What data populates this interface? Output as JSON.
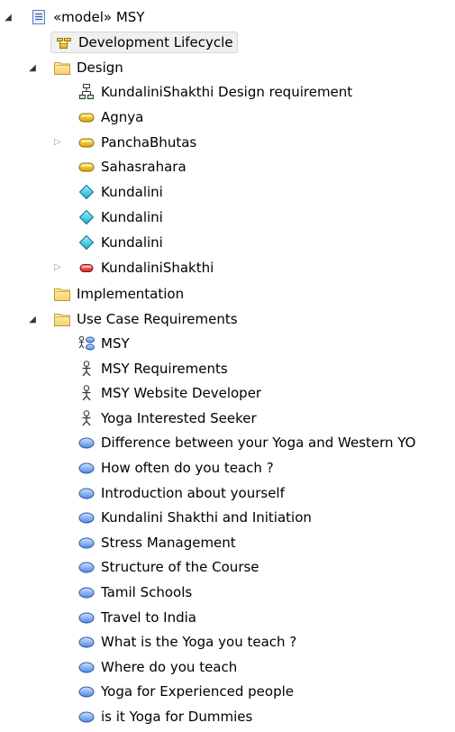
{
  "tree": {
    "root": {
      "label": "«model» MSY",
      "icon": "model-icon"
    },
    "development": {
      "label": "Development Lifecycle",
      "icon": "package-diagram-icon"
    },
    "design": {
      "label": "Design",
      "icon": "folder-icon",
      "items": [
        {
          "label": "KundaliniShakthi Design requirement",
          "icon": "requirement-diagram-icon"
        },
        {
          "label": "Agnya",
          "icon": "yellow-block-icon"
        },
        {
          "label": "PanchaBhutas",
          "icon": "yellow-block-icon"
        },
        {
          "label": "Sahasrahara",
          "icon": "yellow-block-icon"
        },
        {
          "label": "Kundalini",
          "icon": "cyan-diamond-icon"
        },
        {
          "label": "Kundalini",
          "icon": "cyan-diamond-icon"
        },
        {
          "label": "Kundalini",
          "icon": "cyan-diamond-icon"
        },
        {
          "label": "KundaliniShakthi",
          "icon": "red-block-icon"
        }
      ]
    },
    "implementation": {
      "label": "Implementation",
      "icon": "folder-icon"
    },
    "usecase": {
      "label": "Use Case Requirements",
      "icon": "folder-icon",
      "items": [
        {
          "label": "MSY",
          "icon": "usecase-diagram-icon"
        },
        {
          "label": "MSY Requirements",
          "icon": "actor-icon"
        },
        {
          "label": "MSY Website Developer",
          "icon": "actor-icon"
        },
        {
          "label": "Yoga Interested Seeker",
          "icon": "actor-icon"
        },
        {
          "label": "Difference between your Yoga and Western YO",
          "icon": "usecase-ellipse-icon"
        },
        {
          "label": "How often do you teach ?",
          "icon": "usecase-ellipse-icon"
        },
        {
          "label": "Introduction about yourself",
          "icon": "usecase-ellipse-icon"
        },
        {
          "label": "Kundalini Shakthi and Initiation",
          "icon": "usecase-ellipse-icon"
        },
        {
          "label": "Stress Management",
          "icon": "usecase-ellipse-icon"
        },
        {
          "label": "Structure of the Course",
          "icon": "usecase-ellipse-icon"
        },
        {
          "label": "Tamil Schools",
          "icon": "usecase-ellipse-icon"
        },
        {
          "label": "Travel to India",
          "icon": "usecase-ellipse-icon"
        },
        {
          "label": "What is the Yoga you teach ?",
          "icon": "usecase-ellipse-icon"
        },
        {
          "label": "Where do you teach",
          "icon": "usecase-ellipse-icon"
        },
        {
          "label": "Yoga for Experienced people",
          "icon": "usecase-ellipse-icon"
        },
        {
          "label": "is it Yoga for Dummies",
          "icon": "usecase-ellipse-icon"
        }
      ]
    }
  }
}
